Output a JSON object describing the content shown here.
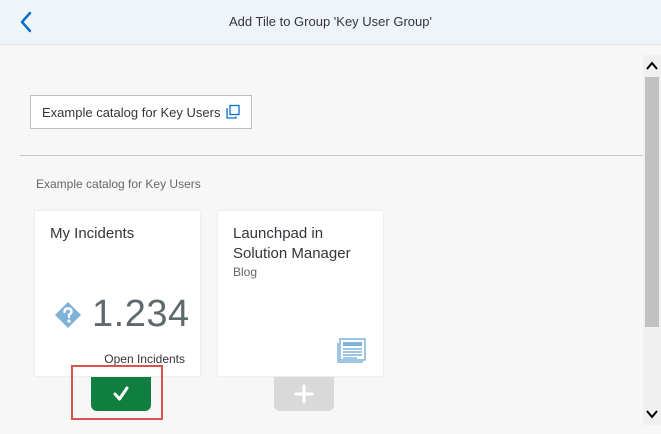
{
  "header": {
    "title": "Add Tile to Group 'Key User Group'",
    "back_icon": "chevron-left-icon"
  },
  "catalog_select": {
    "value": "Example catalog for Key Users",
    "icon": "copy-icon"
  },
  "section": {
    "title": "Example catalog for Key Users"
  },
  "tiles": [
    {
      "title": "My Incidents",
      "kpi_value": "1.234",
      "kpi_icon": "question-diamond-icon",
      "footer": "Open Incidents",
      "added": true
    },
    {
      "title": "Launchpad in Solution Manager",
      "subtitle": "Blog",
      "icon": "news-icon",
      "added": false
    }
  ],
  "colors": {
    "accent": "#0a6ed1",
    "added_green": "#107e3e",
    "add_gray": "#d9d9d9",
    "highlight_red": "#d9534f"
  }
}
